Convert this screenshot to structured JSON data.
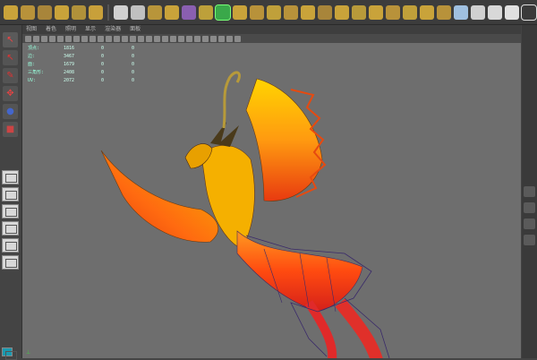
{
  "menu": {
    "items": [
      "视图",
      "着色",
      "照明",
      "显示",
      "渲染器",
      "面板"
    ]
  },
  "hud": {
    "rows": [
      {
        "label": "顶点:",
        "a": "1816",
        "b": "0",
        "c": "0"
      },
      {
        "label": "边:",
        "a": "3467",
        "b": "0",
        "c": "0"
      },
      {
        "label": "面:",
        "a": "1679",
        "b": "0",
        "c": "0"
      },
      {
        "label": "三角形:",
        "a": "2408",
        "b": "0",
        "c": "0"
      },
      {
        "label": "UV:",
        "a": "2072",
        "b": "0",
        "c": "0"
      }
    ]
  },
  "colors": {
    "viewport_bg": "#6e6e6e",
    "accent": "#ffd000",
    "shelf_bg": "#3c3c3c"
  },
  "icons": [
    "select-icon",
    "lasso-icon",
    "paint-select-icon",
    "move-icon",
    "rotate-icon",
    "scale-icon"
  ]
}
